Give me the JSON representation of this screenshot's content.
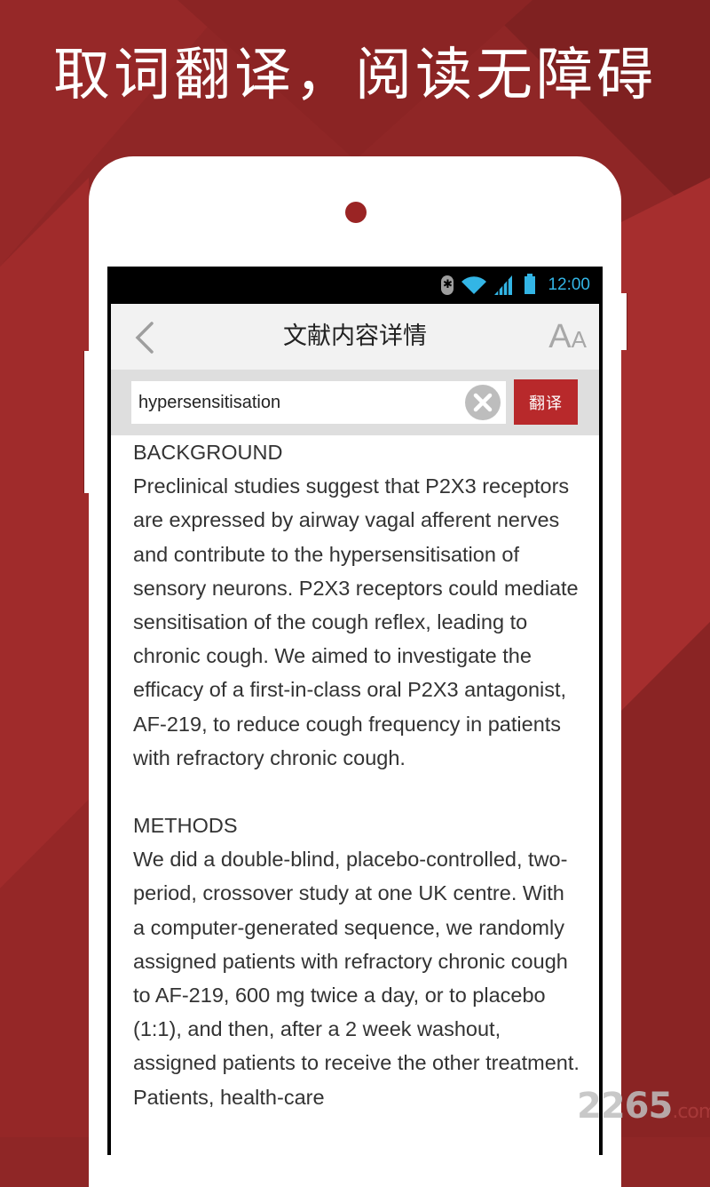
{
  "promo": {
    "headline": "取词翻译，阅读无障碍",
    "brand_color": "#8f2626"
  },
  "status_bar": {
    "time": "12:00",
    "icons": [
      "bluetooth-icon",
      "wifi-icon",
      "signal-icon",
      "battery-icon"
    ],
    "accent_color": "#33b5e5"
  },
  "app_bar": {
    "back_icon": "chevron-left-icon",
    "title": "文献内容详情",
    "font_size_big": "A",
    "font_size_small": "A"
  },
  "search": {
    "value": "hypersensitisation",
    "placeholder": "",
    "clear_icon": "close-circle-icon",
    "translate_label": "翻译",
    "translate_color": "#b8292b"
  },
  "article": {
    "sections": [
      {
        "heading": "BACKGROUND",
        "body": "Preclinical studies suggest that P2X3 receptors are expressed by airway vagal afferent nerves and contribute to the hypersensitisation of sensory neurons. P2X3 receptors could mediate sensitisation of the cough reflex, leading to chronic cough. We aimed to investigate the efficacy of a first-in-class oral P2X3 antagonist, AF-219, to reduce cough frequency in patients with refractory chronic cough."
      },
      {
        "heading": "METHODS",
        "body": "We did a double-blind, placebo-controlled, two-period, crossover study at one UK centre. With a computer-generated sequence, we randomly assigned patients with refractory chronic cough to AF-219, 600 mg twice a day, or to placebo (1:1), and then, after a 2 week washout, assigned patients to receive the other treatment. Patients, health-care"
      }
    ]
  },
  "watermark": {
    "number": "2265",
    "domain": ".com"
  }
}
